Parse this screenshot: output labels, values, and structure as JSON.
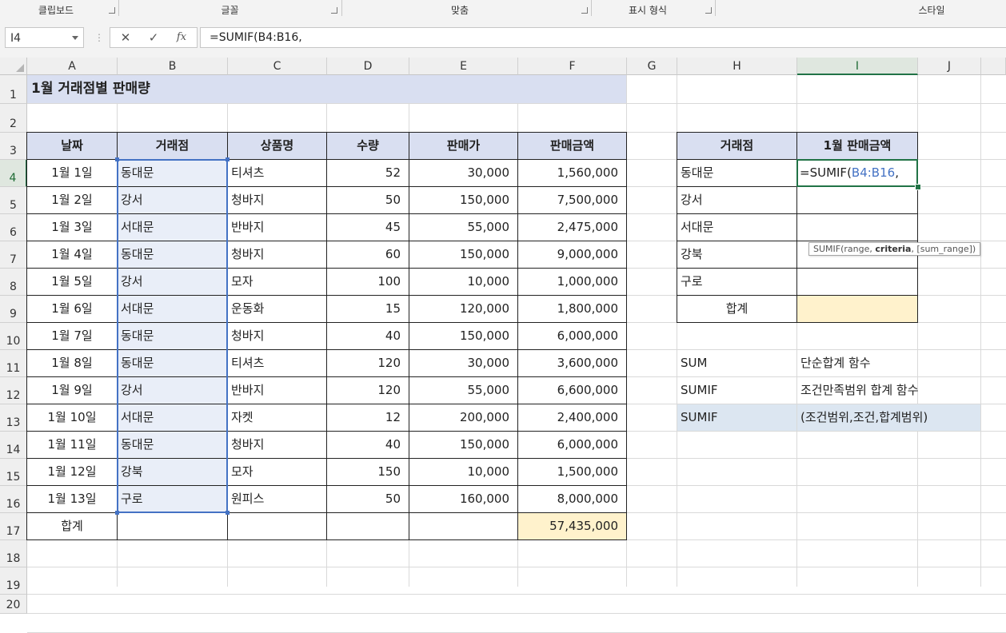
{
  "ribbon": {
    "groups": [
      "클립보드",
      "글꼴",
      "맞춤",
      "표시 형식",
      "스타일"
    ]
  },
  "formula_bar": {
    "name_box": "I4",
    "cancel_icon": "✕",
    "enter_icon": "✓",
    "fx_label": "fx",
    "formula": "=SUMIF(B4:B16,"
  },
  "columns": [
    "A",
    "B",
    "C",
    "D",
    "E",
    "F",
    "G",
    "H",
    "I",
    "J"
  ],
  "rows": [
    "1",
    "2",
    "3",
    "4",
    "5",
    "6",
    "7",
    "8",
    "9",
    "10",
    "11",
    "12",
    "13",
    "14",
    "15",
    "16",
    "17",
    "18",
    "19",
    "20"
  ],
  "sheet": {
    "title": "1월 거래점별 판매량",
    "table_headers": [
      "날짜",
      "거래점",
      "상품명",
      "수량",
      "판매가",
      "판매금액"
    ],
    "table_rows": [
      [
        "1월 1일",
        "동대문",
        "티셔츠",
        "52",
        "30,000",
        "1,560,000"
      ],
      [
        "1월 2일",
        "강서",
        "청바지",
        "50",
        "150,000",
        "7,500,000"
      ],
      [
        "1월 3일",
        "서대문",
        "반바지",
        "45",
        "55,000",
        "2,475,000"
      ],
      [
        "1월 4일",
        "동대문",
        "청바지",
        "60",
        "150,000",
        "9,000,000"
      ],
      [
        "1월 5일",
        "강서",
        "모자",
        "100",
        "10,000",
        "1,000,000"
      ],
      [
        "1월 6일",
        "서대문",
        "운동화",
        "15",
        "120,000",
        "1,800,000"
      ],
      [
        "1월 7일",
        "동대문",
        "청바지",
        "40",
        "150,000",
        "6,000,000"
      ],
      [
        "1월 8일",
        "동대문",
        "티셔츠",
        "120",
        "30,000",
        "3,600,000"
      ],
      [
        "1월 9일",
        "강서",
        "반바지",
        "120",
        "55,000",
        "6,600,000"
      ],
      [
        "1월 10일",
        "서대문",
        "자켓",
        "12",
        "200,000",
        "2,400,000"
      ],
      [
        "1월 11일",
        "동대문",
        "청바지",
        "40",
        "150,000",
        "6,000,000"
      ],
      [
        "1월 12일",
        "강북",
        "모자",
        "150",
        "10,000",
        "1,500,000"
      ],
      [
        "1월 13일",
        "구로",
        "원피스",
        "50",
        "160,000",
        "8,000,000"
      ]
    ],
    "total_label": "합계",
    "total_value": "57,435,000",
    "summary_headers": [
      "거래점",
      "1월 판매금액"
    ],
    "summary_rows": [
      "동대문",
      "강서",
      "서대문",
      "강북",
      "구로"
    ],
    "summary_total_label": "합계",
    "active_formula_prefix": "=SUMIF(",
    "active_formula_ref": "B4:B16",
    "active_formula_suffix": ",",
    "tooltip_prefix": "SUMIF(range, ",
    "tooltip_bold": "criteria",
    "tooltip_suffix": ", [sum_range])",
    "notes": [
      [
        "SUM",
        "단순합계 함수"
      ],
      [
        "SUMIF",
        "조건만족범위 합계 함수"
      ],
      [
        "SUMIF",
        "(조건범위,조건,합계범위)"
      ]
    ]
  }
}
